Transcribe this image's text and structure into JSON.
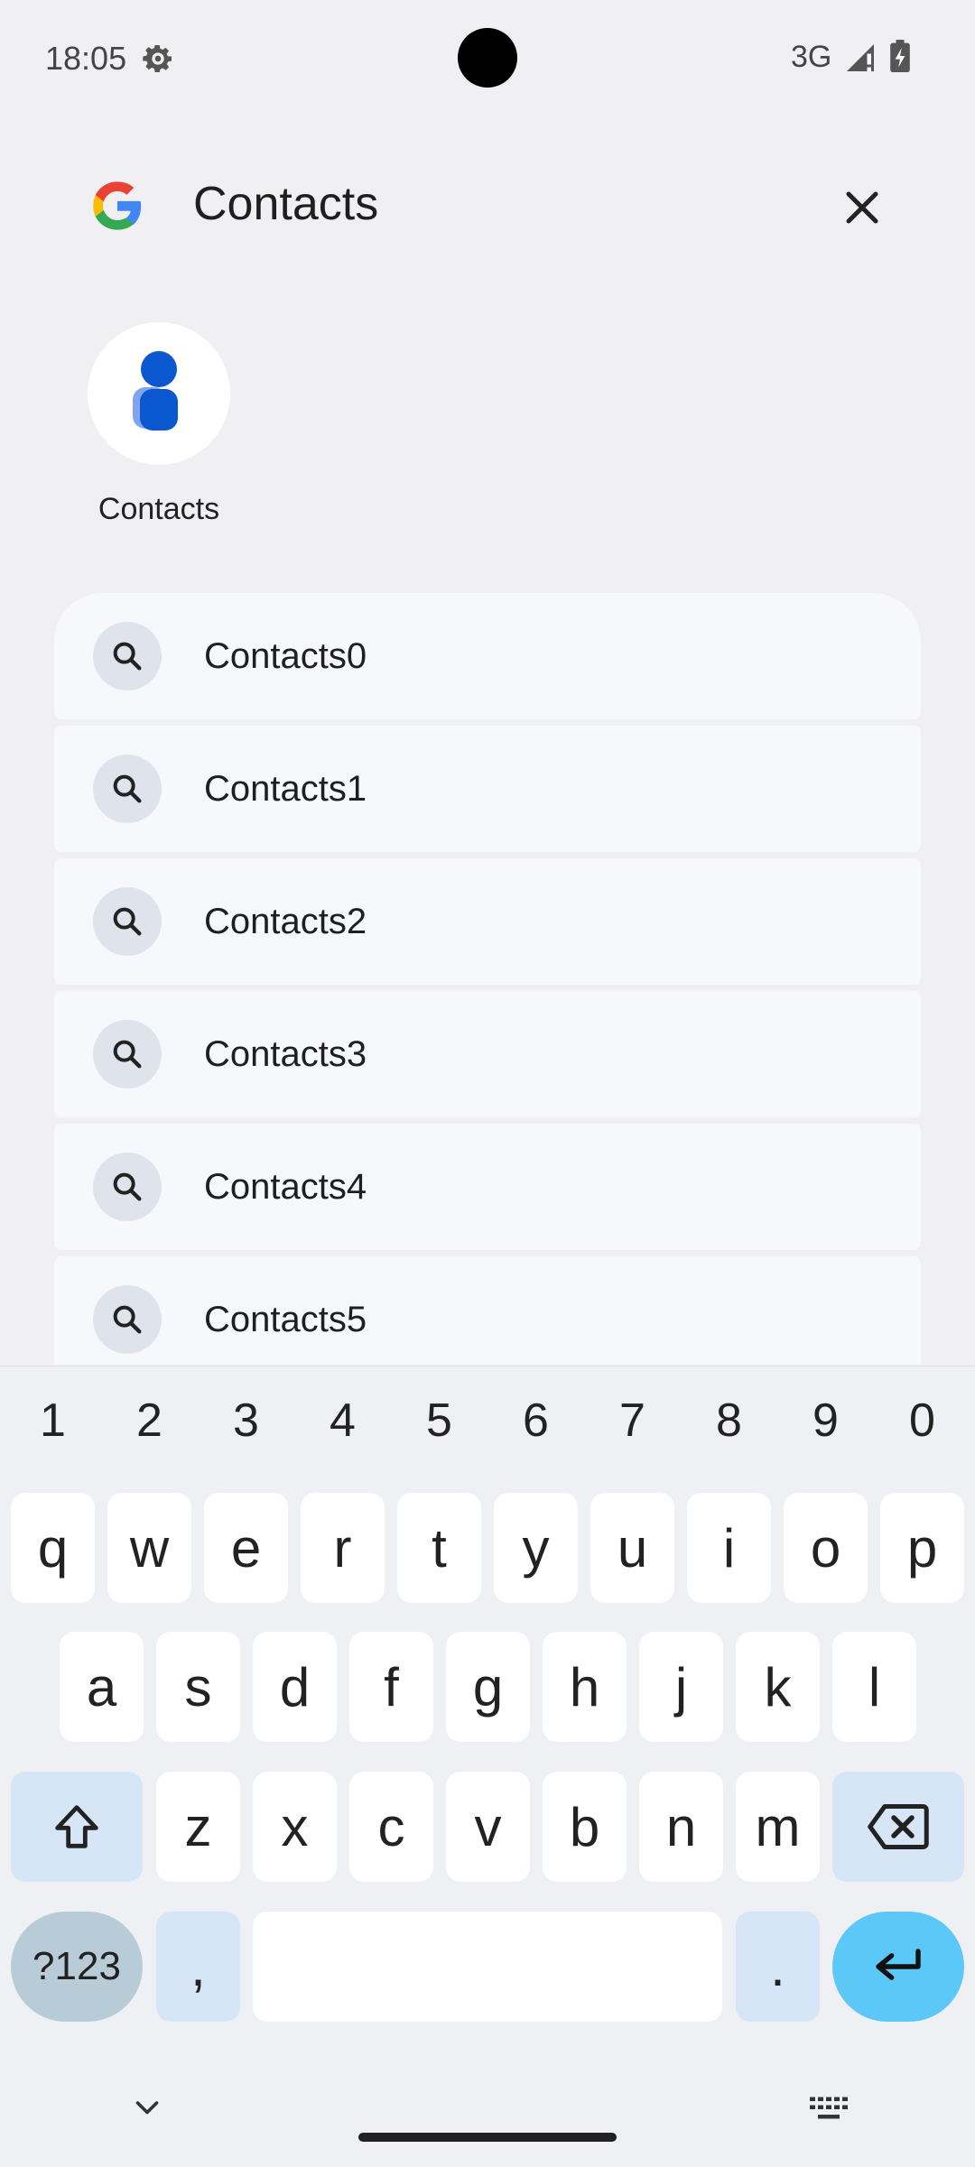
{
  "status_bar": {
    "time": "18:05",
    "network": "3G"
  },
  "search": {
    "query": "Contacts"
  },
  "app_result": {
    "label": "Contacts"
  },
  "suggestions": [
    "Contacts0",
    "Contacts1",
    "Contacts2",
    "Contacts3",
    "Contacts4",
    "Contacts5"
  ],
  "keyboard": {
    "numbers": [
      "1",
      "2",
      "3",
      "4",
      "5",
      "6",
      "7",
      "8",
      "9",
      "0"
    ],
    "row1": [
      "q",
      "w",
      "e",
      "r",
      "t",
      "y",
      "u",
      "i",
      "o",
      "p"
    ],
    "row2": [
      "a",
      "s",
      "d",
      "f",
      "g",
      "h",
      "j",
      "k",
      "l"
    ],
    "row3": [
      "z",
      "x",
      "c",
      "v",
      "b",
      "n",
      "m"
    ],
    "symbols_label": "?123",
    "comma": ",",
    "period": "."
  },
  "colors": {
    "enter_key": "#5cc8f7",
    "modifier_key": "#d6e6f6",
    "symbols_key": "#b8ccd8",
    "contact_icon": "#0b57d0"
  }
}
